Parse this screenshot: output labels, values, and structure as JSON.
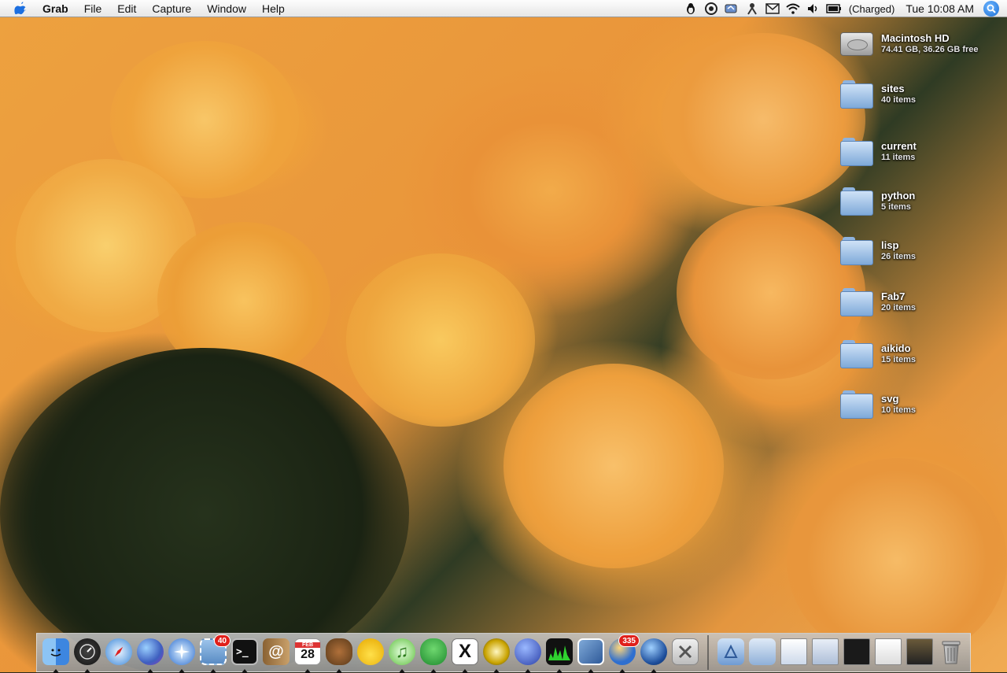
{
  "menubar": {
    "app_name": "Grab",
    "menus": [
      "File",
      "Edit",
      "Capture",
      "Window",
      "Help"
    ],
    "battery_status": "(Charged)",
    "clock": "Tue 10:08 AM"
  },
  "desktop": {
    "drive": {
      "name": "Macintosh HD",
      "info": "74.41 GB, 36.26 GB free"
    },
    "folders": [
      {
        "name": "sites",
        "info": "40 items"
      },
      {
        "name": "current",
        "info": "11 items"
      },
      {
        "name": "python",
        "info": "5 items"
      },
      {
        "name": "lisp",
        "info": "26 items"
      },
      {
        "name": "Fab7",
        "info": "20 items"
      },
      {
        "name": "aikido",
        "info": "15 items"
      },
      {
        "name": "svg",
        "info": "10 items"
      }
    ]
  },
  "dock": {
    "mail_badge": "40",
    "calendar_day": "28",
    "calendar_month": "FEB",
    "news_badge": "335"
  },
  "colors": {
    "accent": "#1a6fd6",
    "badge": "#e0201b"
  }
}
